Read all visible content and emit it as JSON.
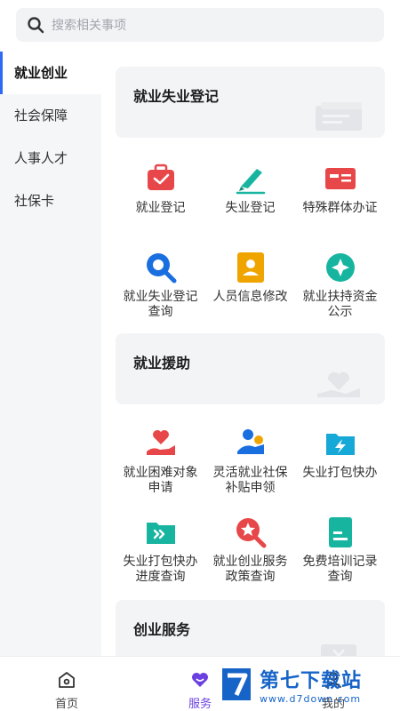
{
  "search": {
    "placeholder": "搜索相关事项"
  },
  "sidebar": {
    "items": [
      {
        "label": "就业创业",
        "active": true
      },
      {
        "label": "社会保障"
      },
      {
        "label": "人事人才"
      },
      {
        "label": "社保卡"
      }
    ]
  },
  "sections": [
    {
      "title": "就业失业登记",
      "items": [
        {
          "label": "就业登记",
          "icon": "briefcase-icon"
        },
        {
          "label": "失业登记",
          "icon": "pen-icon"
        },
        {
          "label": "特殊群体办证",
          "icon": "id-card-icon"
        },
        {
          "label": "就业失业登记查询",
          "icon": "magnifier-icon"
        },
        {
          "label": "人员信息修改",
          "icon": "person-card-icon"
        },
        {
          "label": "就业扶持资金公示",
          "icon": "diamond-star-icon"
        }
      ]
    },
    {
      "title": "就业援助",
      "items": [
        {
          "label": "就业困难对象申请",
          "icon": "heart-hand-icon"
        },
        {
          "label": "灵活就业社保补贴申领",
          "icon": "person-coin-icon"
        },
        {
          "label": "失业打包快办",
          "icon": "folder-bolt-icon"
        },
        {
          "label": "失业打包快办进度查询",
          "icon": "folder-arrow-icon"
        },
        {
          "label": "就业创业服务政策查询",
          "icon": "star-search-icon"
        },
        {
          "label": "免费培训记录查询",
          "icon": "document-icon"
        }
      ]
    },
    {
      "title": "创业服务"
    }
  ],
  "tabbar": {
    "items": [
      {
        "label": "首页",
        "icon": "home-icon"
      },
      {
        "label": "服务",
        "icon": "service-icon",
        "active": true
      },
      {
        "label": "我的",
        "icon": "user-icon"
      }
    ]
  },
  "watermark": {
    "brand": "第七下载站",
    "url": "www.d7down.com"
  },
  "colors": {
    "accent": "#2f6bf2",
    "red": "#e8474a",
    "blue": "#1a6fe0",
    "teal": "#17b5a0",
    "orange": "#f0a400",
    "purple": "#6b40e0"
  }
}
